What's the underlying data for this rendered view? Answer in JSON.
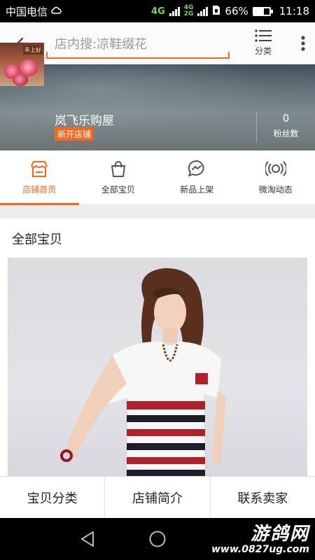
{
  "status_bar": {
    "carrier": "中国电信",
    "net_badge_top": "4G",
    "net_badge_small": "4G",
    "net_badge_small2": "2G",
    "battery_text": "66%",
    "battery_level": 0.66,
    "time": "11:18"
  },
  "header": {
    "search_placeholder": "店内搜:凉鞋缀花",
    "category_label": "分类"
  },
  "shop": {
    "name": "岚飞乐购屋",
    "badge": "新开店铺",
    "fans_count": "0",
    "fans_label": "粉丝数",
    "logo_text": "丰上好"
  },
  "tabs": [
    {
      "label": "店铺首页",
      "icon": "store-icon",
      "active": true
    },
    {
      "label": "全部宝贝",
      "icon": "bag-icon",
      "active": false
    },
    {
      "label": "新品上架",
      "icon": "chat-bubble-icon",
      "active": false
    },
    {
      "label": "微淘动态",
      "icon": "broadcast-icon",
      "active": false
    }
  ],
  "content": {
    "section_title": "全部宝贝"
  },
  "bottom_bar": {
    "category": "宝贝分类",
    "intro": "店铺简介",
    "contact": "联系卖家"
  },
  "watermark": {
    "title": "游鸽网",
    "url": "www.0827ug.com"
  },
  "colors": {
    "accent": "#f4671d",
    "status_bar": "#000000",
    "nav_bar": "#000000"
  }
}
